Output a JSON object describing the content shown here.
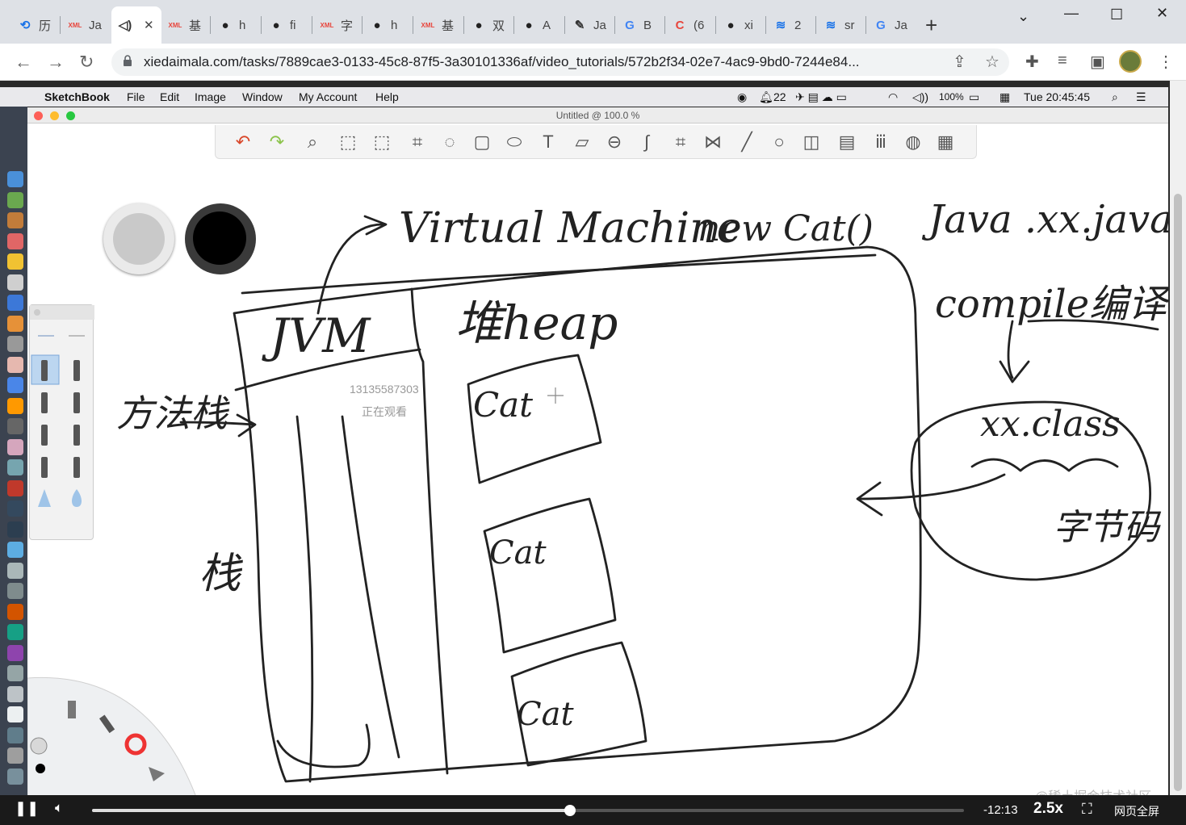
{
  "browser": {
    "tabs": [
      {
        "icon": "history-icon",
        "label": "历",
        "color": "#1a73e8"
      },
      {
        "icon": "xml-icon",
        "label": "Ja",
        "color": "#e8453c"
      },
      {
        "icon": "audio-icon",
        "label": "",
        "color": "#333"
      },
      {
        "icon": "xml-icon",
        "label": "基",
        "color": "#e8453c"
      },
      {
        "icon": "github-icon",
        "label": "h",
        "color": "#222"
      },
      {
        "icon": "github-icon",
        "label": "fi",
        "color": "#222"
      },
      {
        "icon": "xml-icon",
        "label": "字",
        "color": "#e8453c"
      },
      {
        "icon": "github-icon",
        "label": "h",
        "color": "#222"
      },
      {
        "icon": "xml-icon",
        "label": "基",
        "color": "#e8453c"
      },
      {
        "icon": "github-icon",
        "label": "双",
        "color": "#222"
      },
      {
        "icon": "github-icon",
        "label": "A",
        "color": "#222"
      },
      {
        "icon": "assist-icon",
        "label": "Ja",
        "color": "#333"
      },
      {
        "icon": "google-icon",
        "label": "B",
        "color": "#4285f4"
      },
      {
        "icon": "c-icon",
        "label": "(6",
        "color": "#e8453c"
      },
      {
        "icon": "github-icon",
        "label": "xi",
        "color": "#222"
      },
      {
        "icon": "layers-icon",
        "label": "2",
        "color": "#1a73e8"
      },
      {
        "icon": "layers-icon",
        "label": "sr",
        "color": "#1a73e8"
      },
      {
        "icon": "google-icon",
        "label": "Ja",
        "color": "#4285f4"
      }
    ],
    "url": "xiedaimala.com/tasks/7889cae3-0133-45c8-87f5-3a30101336af/video_tutorials/572b2f34-02e7-4ac9-9bd0-7244e84..."
  },
  "mac_menu": {
    "app": "SketchBook",
    "items": [
      "File",
      "Edit",
      "Image",
      "Window",
      "My Account",
      "Help"
    ],
    "notif_count": "22",
    "battery": "100%",
    "clock": "Tue 20:45:45"
  },
  "sketchbook": {
    "title": "Untitled @ 100.0 %"
  },
  "drawing_text": {
    "virtual_machine": "Virtual Machine",
    "new_cat": "new Cat()",
    "java_file": "Java .xx.java",
    "compile": "compile编译",
    "xx_class": "xx.class",
    "bytecode": "字节码",
    "jvm": "JVM",
    "heap": "堆heap",
    "method_stack": "方法栈",
    "stack": "栈",
    "cat1": "Cat",
    "cat2": "Cat",
    "cat3": "Cat"
  },
  "overlay": {
    "phone": "13135587303",
    "watching": "正在观看"
  },
  "player": {
    "time_remaining": "-12:13",
    "speed": "2.5x",
    "fullscreen_web": "网页全屏",
    "progress": 0.548
  },
  "watermark": "@稀土掘金技术社区"
}
